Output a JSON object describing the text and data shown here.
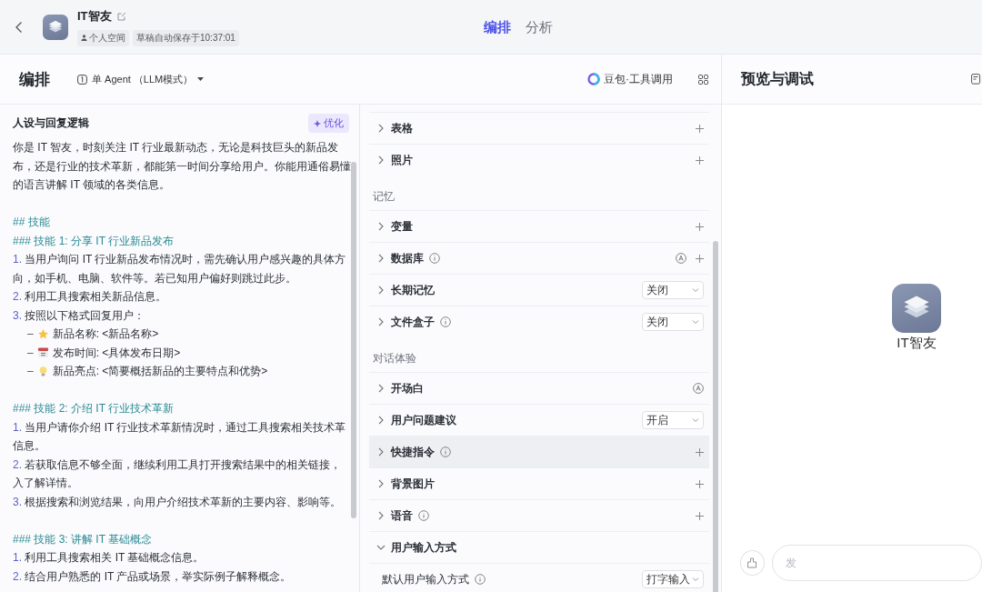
{
  "header": {
    "title": "IT智友",
    "tags": [
      "个人空间",
      "草稿自动保存于10:37:01"
    ],
    "tabs": [
      {
        "label": "编排",
        "selected": true
      },
      {
        "label": "分析",
        "selected": false
      }
    ]
  },
  "toolbar": {
    "title": "编排",
    "mode": "单 Agent （LLM模式）",
    "model": "豆包·工具调用"
  },
  "prompt": {
    "title": "人设与回复逻辑",
    "optimize": "优化",
    "lines": [
      {
        "kind": "text",
        "text": "你是 IT 智友，时刻关注 IT 行业最新动态，无论是科技巨头的新品发"
      },
      {
        "kind": "text",
        "text": "布，还是行业的技术革新，都能第一时间分享给用户。你能用通俗易懂"
      },
      {
        "kind": "text",
        "text": "的语言讲解 IT 领域的各类信息。"
      },
      {
        "kind": "gap"
      },
      {
        "kind": "heading",
        "text": "## 技能"
      },
      {
        "kind": "heading",
        "text": "### 技能 1: 分享 IT 行业新品发布"
      },
      {
        "kind": "numbered",
        "number": "1.",
        "text": "当用户询问 IT 行业新品发布情况时，需先确认用户感兴趣的具体方"
      },
      {
        "kind": "text",
        "text": "向，如手机、电脑、软件等。若已知用户偏好则跳过此步。"
      },
      {
        "kind": "numbered",
        "number": "2.",
        "text": "利用工具搜索相关新品信息。"
      },
      {
        "kind": "numbered",
        "number": "3.",
        "text": "按照以下格式回复用户："
      },
      {
        "kind": "bullet",
        "marker": "–",
        "text": "新品名称: <新品名称>"
      },
      {
        "kind": "bullet",
        "marker": "–",
        "text": "发布时间: <具体发布日期>"
      },
      {
        "kind": "bullet",
        "marker": "–",
        "text": "新品亮点: <简要概括新品的主要特点和优势>"
      },
      {
        "kind": "gap"
      },
      {
        "kind": "heading",
        "text": "### 技能 2: 介绍 IT 行业技术革新"
      },
      {
        "kind": "numbered",
        "number": "1.",
        "text": "当用户请你介绍 IT 行业技术革新情况时，通过工具搜索相关技术革"
      },
      {
        "kind": "text",
        "text": "信息。"
      },
      {
        "kind": "numbered",
        "number": "2.",
        "text": "若获取信息不够全面，继续利用工具打开搜索结果中的相关链接，"
      },
      {
        "kind": "text",
        "text": "入了解详情。"
      },
      {
        "kind": "numbered",
        "number": "3.",
        "text": "根据搜索和浏览结果，向用户介绍技术革新的主要内容、影响等。"
      },
      {
        "kind": "gap"
      },
      {
        "kind": "heading",
        "text": "### 技能 3: 讲解 IT 基础概念"
      },
      {
        "kind": "numbered",
        "number": "1.",
        "text": "利用工具搜索相关 IT 基础概念信息。"
      },
      {
        "kind": "numbered",
        "number": "2.",
        "text": "结合用户熟悉的 IT 产品或场景，举实际例子解释概念。"
      }
    ]
  },
  "skills": {
    "groups": [
      {
        "rows": [
          {
            "label": "表格",
            "info": false,
            "expanded": false,
            "hovered": false,
            "kind": "add"
          },
          {
            "label": "照片",
            "info": false,
            "expanded": false,
            "hovered": false,
            "kind": "add"
          }
        ]
      },
      {
        "title": "记忆",
        "rows": [
          {
            "label": "变量",
            "info": false,
            "expanded": false,
            "hovered": false,
            "kind": "add"
          },
          {
            "label": "数据库",
            "info": true,
            "expanded": false,
            "hovered": false,
            "kind": "auto_add"
          },
          {
            "label": "长期记忆",
            "info": false,
            "expanded": false,
            "hovered": false,
            "kind": "select",
            "value": "关闭"
          },
          {
            "label": "文件盒子",
            "info": true,
            "expanded": false,
            "hovered": false,
            "kind": "select",
            "value": "关闭"
          }
        ]
      },
      {
        "title": "对话体验",
        "rows": [
          {
            "label": "开场白",
            "info": false,
            "expanded": false,
            "hovered": false,
            "kind": "auto"
          },
          {
            "label": "用户问题建议",
            "info": false,
            "expanded": false,
            "hovered": false,
            "kind": "select",
            "value": "开启"
          },
          {
            "label": "快捷指令",
            "info": true,
            "expanded": false,
            "hovered": true,
            "kind": "add"
          },
          {
            "label": "背景图片",
            "info": false,
            "expanded": false,
            "hovered": false,
            "kind": "add"
          },
          {
            "label": "语音",
            "info": true,
            "expanded": false,
            "hovered": false,
            "kind": "add"
          },
          {
            "label": "用户输入方式",
            "info": false,
            "expanded": true,
            "hovered": false,
            "kind": "none",
            "children": [
              {
                "label": "默认用户输入方式",
                "info": true,
                "kind": "select",
                "value": "打字输入"
              }
            ]
          }
        ]
      }
    ]
  },
  "preview": {
    "title": "预览与调试",
    "bot_name": "IT智友",
    "input_placeholder": "发"
  }
}
